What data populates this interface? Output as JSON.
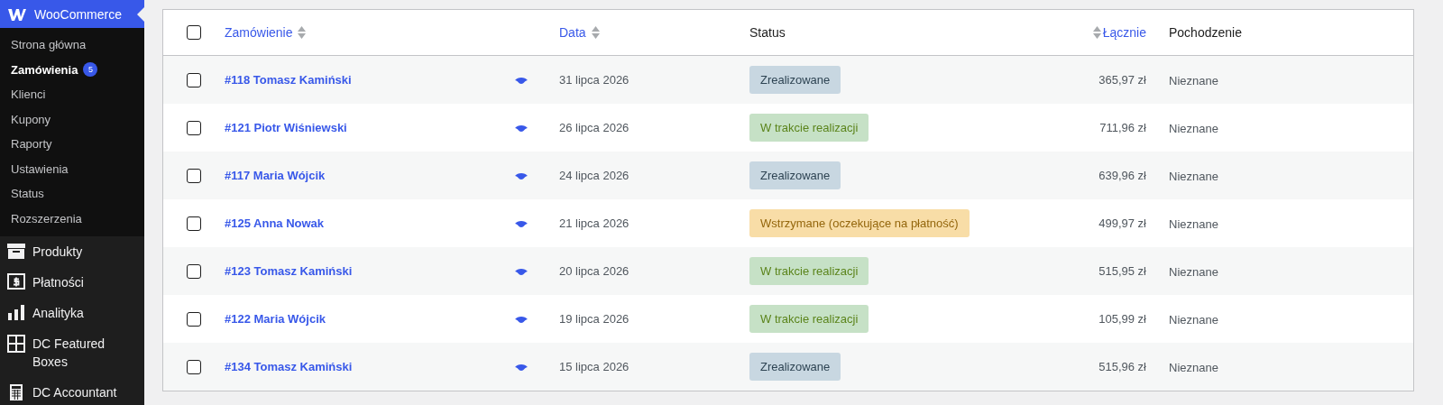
{
  "sidebar": {
    "header": {
      "label": "WooCommerce",
      "selected": true
    },
    "submenu": [
      {
        "label": "Strona główna",
        "selected": false
      },
      {
        "label": "Zamówienia",
        "selected": true,
        "badge": "5"
      },
      {
        "label": "Klienci",
        "selected": false
      },
      {
        "label": "Kupony",
        "selected": false
      },
      {
        "label": "Raporty",
        "selected": false
      },
      {
        "label": "Ustawienia",
        "selected": false
      },
      {
        "label": "Status",
        "selected": false
      },
      {
        "label": "Rozszerzenia",
        "selected": false
      }
    ],
    "menu": [
      {
        "label": "Produkty",
        "kind": "box",
        "selected": false
      },
      {
        "label": "Płatności",
        "kind": "dollar",
        "selected": false
      },
      {
        "label": "Analityka",
        "kind": "bars",
        "selected": false
      },
      {
        "label": "DC Featured Boxes",
        "kind": "grid",
        "selected": false
      },
      {
        "label": "DC Accountant",
        "kind": "calculator",
        "selected": false
      }
    ]
  },
  "table": {
    "select_all": {
      "checked": false
    },
    "columns": [
      {
        "label": "Zamówienie",
        "sortable": true
      },
      {
        "label": "Data",
        "sortable": true
      },
      {
        "label": "Status",
        "sortable": false
      },
      {
        "label": "Łącznie",
        "sortable": true
      },
      {
        "label": "Pochodzenie",
        "sortable": false
      }
    ],
    "rows": [
      {
        "checked": false,
        "order": "#118 Tomasz Kamiński",
        "date": "31 lipca 2026",
        "status": "Zrealizowane",
        "kind": "completed",
        "total": "365,97 zł",
        "origin": "Nieznane"
      },
      {
        "checked": false,
        "order": "#121 Piotr Wiśniewski",
        "date": "26 lipca 2026",
        "status": "W trakcie realizacji",
        "kind": "processing",
        "total": "711,96 zł",
        "origin": "Nieznane"
      },
      {
        "checked": false,
        "order": "#117 Maria Wójcik",
        "date": "24 lipca 2026",
        "status": "Zrealizowane",
        "kind": "completed",
        "total": "639,96 zł",
        "origin": "Nieznane"
      },
      {
        "checked": false,
        "order": "#125 Anna Nowak",
        "date": "21 lipca 2026",
        "status": "Wstrzymane (oczekujące na płatność)",
        "kind": "on-hold",
        "total": "499,97 zł",
        "origin": "Nieznane"
      },
      {
        "checked": false,
        "order": "#123 Tomasz Kamiński",
        "date": "20 lipca 2026",
        "status": "W trakcie realizacji",
        "kind": "processing",
        "total": "515,95 zł",
        "origin": "Nieznane"
      },
      {
        "checked": false,
        "order": "#122 Maria Wójcik",
        "date": "19 lipca 2026",
        "status": "W trakcie realizacji",
        "kind": "processing",
        "total": "105,99 zł",
        "origin": "Nieznane"
      },
      {
        "checked": false,
        "order": "#134 Tomasz Kamiński",
        "date": "15 lipca 2026",
        "status": "Zrealizowane",
        "kind": "completed",
        "total": "515,96 zł",
        "origin": "Nieznane"
      }
    ]
  }
}
